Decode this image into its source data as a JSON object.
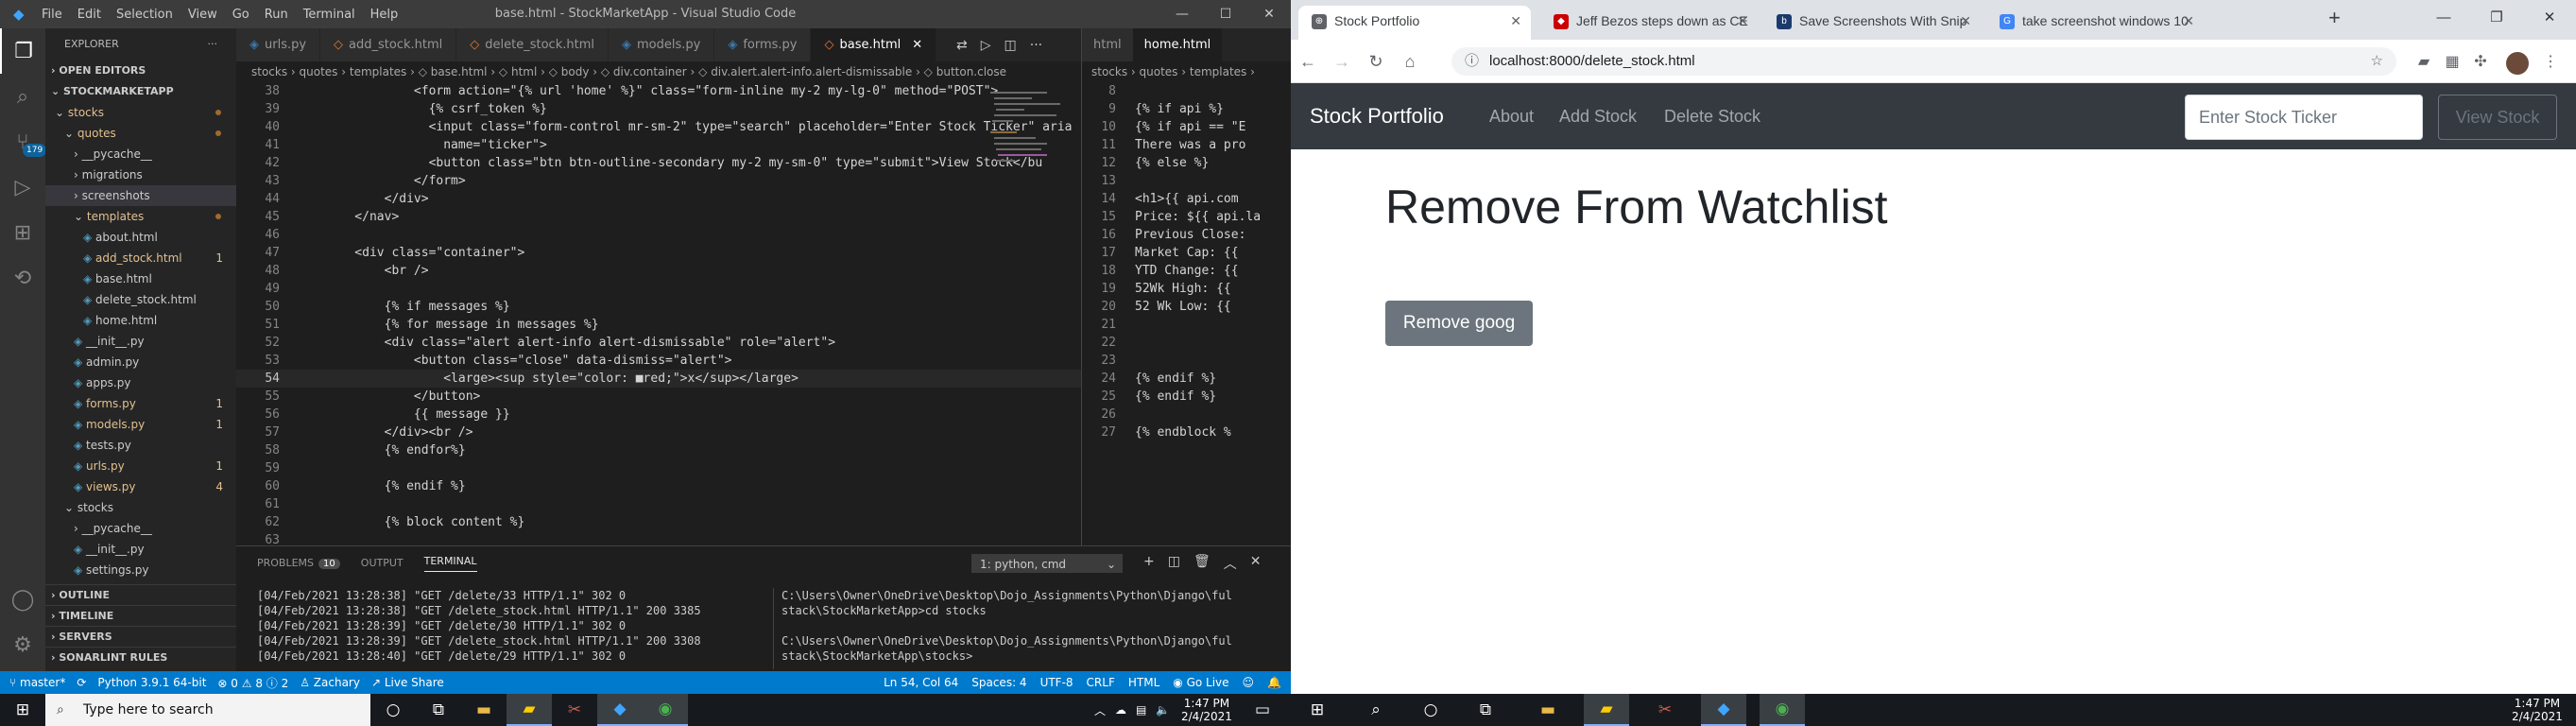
{
  "vscode": {
    "title": "base.html - StockMarketApp - Visual Studio Code",
    "menu": [
      "File",
      "Edit",
      "Selection",
      "View",
      "Go",
      "Run",
      "Terminal",
      "Help"
    ],
    "explorer": {
      "title": "EXPLORER",
      "open_editors": "OPEN EDITORS",
      "project": "STOCKMARKETAPP",
      "tree": [
        {
          "label": "stocks",
          "indent": 1,
          "kind": "folder-open",
          "color": "#e2c08d",
          "dot": true
        },
        {
          "label": "quotes",
          "indent": 2,
          "kind": "folder-open",
          "color": "#e2c08d",
          "dot": true
        },
        {
          "label": "__pycache__",
          "indent": 3,
          "kind": "folder",
          "color": "#ccc"
        },
        {
          "label": "migrations",
          "indent": 3,
          "kind": "folder",
          "color": "#ccc"
        },
        {
          "label": "screenshots",
          "indent": 3,
          "kind": "folder",
          "color": "#ccc",
          "selected": true
        },
        {
          "label": "templates",
          "indent": 3,
          "kind": "folder-open",
          "color": "#e2c08d",
          "dot": true
        },
        {
          "label": "about.html",
          "indent": 4,
          "kind": "file",
          "color": "#ccc"
        },
        {
          "label": "add_stock.html",
          "indent": 4,
          "kind": "file",
          "color": "#e2c08d",
          "count": "1"
        },
        {
          "label": "base.html",
          "indent": 4,
          "kind": "file",
          "color": "#ccc"
        },
        {
          "label": "delete_stock.html",
          "indent": 4,
          "kind": "file",
          "color": "#ccc"
        },
        {
          "label": "home.html",
          "indent": 4,
          "kind": "file",
          "color": "#ccc"
        },
        {
          "label": "__init__.py",
          "indent": 3,
          "kind": "file",
          "color": "#ccc"
        },
        {
          "label": "admin.py",
          "indent": 3,
          "kind": "file",
          "color": "#ccc"
        },
        {
          "label": "apps.py",
          "indent": 3,
          "kind": "file",
          "color": "#ccc"
        },
        {
          "label": "forms.py",
          "indent": 3,
          "kind": "file",
          "color": "#e2c08d",
          "count": "1"
        },
        {
          "label": "models.py",
          "indent": 3,
          "kind": "file",
          "color": "#e2c08d",
          "count": "1"
        },
        {
          "label": "tests.py",
          "indent": 3,
          "kind": "file",
          "color": "#ccc"
        },
        {
          "label": "urls.py",
          "indent": 3,
          "kind": "file",
          "color": "#e2c08d",
          "count": "1"
        },
        {
          "label": "views.py",
          "indent": 3,
          "kind": "file",
          "color": "#e2c08d",
          "count": "4"
        },
        {
          "label": "stocks",
          "indent": 2,
          "kind": "folder-open",
          "color": "#ccc"
        },
        {
          "label": "__pycache__",
          "indent": 3,
          "kind": "folder",
          "color": "#ccc"
        },
        {
          "label": "__init__.py",
          "indent": 3,
          "kind": "file",
          "color": "#ccc"
        },
        {
          "label": "settings.py",
          "indent": 3,
          "kind": "file",
          "color": "#ccc"
        }
      ],
      "bottom": [
        "OUTLINE",
        "TIMELINE",
        "SERVERS",
        "SONARLINT RULES"
      ]
    },
    "tabs": [
      {
        "label": "urls.py",
        "icon": "python-icon"
      },
      {
        "label": "add_stock.html",
        "icon": "html-icon"
      },
      {
        "label": "delete_stock.html",
        "icon": "html-icon"
      },
      {
        "label": "models.py",
        "icon": "python-icon"
      },
      {
        "label": "forms.py",
        "icon": "python-icon"
      },
      {
        "label": "base.html",
        "icon": "html-icon",
        "active": true
      }
    ],
    "breadcrumb": "stocks › quotes › templates › ◇ base.html › ◇ html › ◇ body › ◇ div.container › ◇ div.alert.alert-info.alert-dismissable › ◇ button.close",
    "code": [
      {
        "n": "38",
        "t": "            <form action=\"{% url 'home' %}\" class=\"form-inline my-2 my-lg-0\" method=\"POST\">"
      },
      {
        "n": "39",
        "t": "              {% csrf_token %}"
      },
      {
        "n": "40",
        "t": "              <input class=\"form-control mr-sm-2\" type=\"search\" placeholder=\"Enter Stock Ticker\" aria"
      },
      {
        "n": "41",
        "t": "                name=\"ticker\">"
      },
      {
        "n": "42",
        "t": "              <button class=\"btn btn-outline-secondary my-2 my-sm-0\" type=\"submit\">View Stock</bu"
      },
      {
        "n": "43",
        "t": "            </form>"
      },
      {
        "n": "44",
        "t": "        </div>"
      },
      {
        "n": "45",
        "t": "    </nav>"
      },
      {
        "n": "46",
        "t": ""
      },
      {
        "n": "47",
        "t": "    <div class=\"container\">"
      },
      {
        "n": "48",
        "t": "        <br />"
      },
      {
        "n": "49",
        "t": ""
      },
      {
        "n": "50",
        "t": "        {% if messages %}"
      },
      {
        "n": "51",
        "t": "        {% for message in messages %}"
      },
      {
        "n": "52",
        "t": "        <div class=\"alert alert-info alert-dismissable\" role=\"alert\">"
      },
      {
        "n": "53",
        "t": "            <button class=\"close\" data-dismiss=\"alert\">"
      },
      {
        "n": "54",
        "t": "                <large><sup style=\"color: ■red;\">x</sup></large>",
        "cur": true
      },
      {
        "n": "55",
        "t": "            </button>"
      },
      {
        "n": "56",
        "t": "            {{ message }}"
      },
      {
        "n": "57",
        "t": "        </div><br />"
      },
      {
        "n": "58",
        "t": "        {% endfor%}"
      },
      {
        "n": "59",
        "t": ""
      },
      {
        "n": "60",
        "t": "        {% endif %}"
      },
      {
        "n": "61",
        "t": ""
      },
      {
        "n": "62",
        "t": "        {% block content %}"
      },
      {
        "n": "63",
        "t": ""
      }
    ],
    "pane2": {
      "tabs": [
        "html",
        "home.html"
      ],
      "breadcrumb": "stocks › quotes › templates ›",
      "code": [
        {
          "n": "8",
          "t": ""
        },
        {
          "n": "9",
          "t": "{% if api %}"
        },
        {
          "n": "10",
          "t": "{% if api == \"E"
        },
        {
          "n": "11",
          "t": "There was a pro"
        },
        {
          "n": "12",
          "t": "{% else %}"
        },
        {
          "n": "13",
          "t": ""
        },
        {
          "n": "14",
          "t": "<h1>{{ api.com"
        },
        {
          "n": "15",
          "t": "Price: ${{ api.la"
        },
        {
          "n": "16",
          "t": "Previous Close:"
        },
        {
          "n": "17",
          "t": "Market Cap: {{"
        },
        {
          "n": "18",
          "t": "YTD Change: {{"
        },
        {
          "n": "19",
          "t": "52Wk High: {{"
        },
        {
          "n": "20",
          "t": "52 Wk Low: {{"
        },
        {
          "n": "21",
          "t": ""
        },
        {
          "n": "22",
          "t": ""
        },
        {
          "n": "23",
          "t": ""
        },
        {
          "n": "24",
          "t": "{% endif %}"
        },
        {
          "n": "25",
          "t": "{% endif %}"
        },
        {
          "n": "26",
          "t": ""
        },
        {
          "n": "27",
          "t": "{% endblock %"
        }
      ]
    },
    "panel": {
      "tabs": [
        "PROBLEMS",
        "OUTPUT",
        "TERMINAL"
      ],
      "problems_count": "10",
      "terminal_select": "1: python, cmd",
      "log_left": "[04/Feb/2021 13:28:38] \"GET /delete/33 HTTP/1.1\" 302 0\n[04/Feb/2021 13:28:38] \"GET /delete_stock.html HTTP/1.1\" 200 3385\n[04/Feb/2021 13:28:39] \"GET /delete/30 HTTP/1.1\" 302 0\n[04/Feb/2021 13:28:39] \"GET /delete_stock.html HTTP/1.1\" 200 3308\n[04/Feb/2021 13:28:40] \"GET /delete/29 HTTP/1.1\" 302 0",
      "log_right": "C:\\Users\\Owner\\OneDrive\\Desktop\\Dojo_Assignments\\Python\\Django\\ful\nstack\\StockMarketApp>cd stocks\n\nC:\\Users\\Owner\\OneDrive\\Desktop\\Dojo_Assignments\\Python\\Django\\ful\nstack\\StockMarketApp\\stocks>"
    },
    "status": {
      "branch": "master*",
      "python": "Python 3.9.1 64-bit",
      "problems": "⊗ 0 ⚠ 8 ⓘ 2",
      "user": "Zachary",
      "liveshare": "Live Share",
      "position": "Ln 54, Col 64",
      "spaces": "Spaces: 4",
      "encoding": "UTF-8",
      "eol": "CRLF",
      "lang": "HTML",
      "golive": "Go Live"
    },
    "activity_badge": "179"
  },
  "chrome": {
    "tabs": [
      {
        "label": "Stock Portfolio",
        "active": true,
        "fav_color": "#5f6368",
        "fav": "⊕"
      },
      {
        "label": "Jeff Bezos steps down as CE",
        "fav_color": "#c00",
        "fav": "cnbc"
      },
      {
        "label": "Save Screenshots With Snip",
        "fav_color": "#1b3a6b",
        "fav": "b"
      },
      {
        "label": "take screenshot windows 10",
        "fav_color": "#4285f4",
        "fav": "G"
      }
    ],
    "url": "localhost:8000/delete_stock.html",
    "page": {
      "brand": "Stock Portfolio",
      "nav": [
        "About",
        "Add Stock",
        "Delete Stock"
      ],
      "ticker_placeholder": "Enter Stock Ticker",
      "view_button": "View Stock",
      "heading": "Remove From Watchlist",
      "remove_button": "Remove goog"
    }
  },
  "taskbar": {
    "search_placeholder": "Type here to search",
    "left_clock": {
      "time": "1:47 PM",
      "date": "2/4/2021"
    },
    "right_clock": {
      "time": "1:47 PM",
      "date": "2/4/2021"
    }
  }
}
